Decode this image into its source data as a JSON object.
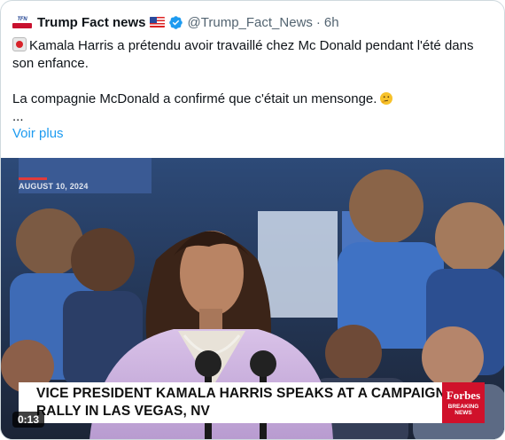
{
  "author": {
    "avatar_text": "TFN",
    "name": "Trump Fact news",
    "flag": "us-flag-icon",
    "verified": "verified-badge-icon",
    "handle": "@Trump_Fact_News",
    "separator": "·",
    "time": "6h"
  },
  "tweet": {
    "line1": "Kamala Harris a prétendu avoir travaillé chez Mc Donald pendant l'été dans son enfance.",
    "line2": "La compagnie McDonald a confirmé que c'était un mensonge.",
    "ellipsis": "...",
    "show_more": "Voir plus"
  },
  "video": {
    "date_stamp": "AUGUST 10, 2024",
    "caption_line1": "VICE PRESIDENT KAMALA HARRIS SPEAKS AT A CAMPAIGN",
    "caption_line2": "RALLY IN LAS VEGAS, NV",
    "brand": "Forbes",
    "brand_sub1": "BREAKING",
    "brand_sub2": "NEWS",
    "duration": "0:13"
  },
  "colors": {
    "link": "#1d9bf0",
    "verified": "#1d9bf0",
    "muted": "#536471",
    "brand_red": "#d0112b"
  }
}
